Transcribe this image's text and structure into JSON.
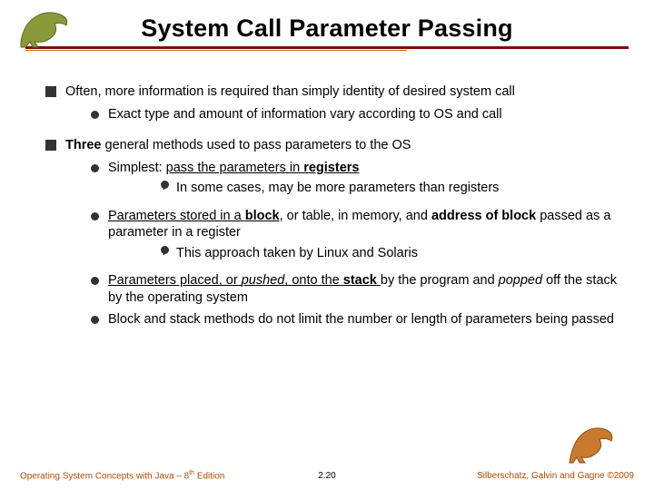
{
  "title": "System Call Parameter Passing",
  "bullets": {
    "a": {
      "text_pre": "Often, more information is required than simply identity of desired system call",
      "sub1": "Exact type and amount of information vary according to OS and call"
    },
    "b": {
      "text_pre": "Three",
      "text_post": " general methods used to pass parameters to the OS",
      "m1": {
        "pre": "Simplest:  ",
        "u": "pass the parameters in ",
        "ub": "registers",
        "sub": "In some cases, may be more parameters than registers"
      },
      "m2": {
        "u1": "Parameters stored in a ",
        "ub1": "block",
        "mid": ", or table, in memory, and ",
        "b2": "address of block",
        "post": " passed as a parameter in a register",
        "sub": "This approach taken by Linux and Solaris"
      },
      "m3": {
        "u1": "Parameters placed, or ",
        "ui": "pushed",
        "u2": ", onto the ",
        "ub": "stack ",
        "mid": "by the program and ",
        "i2": "popped",
        "post": " off the stack by the operating system"
      },
      "m4": "Block and stack methods do not limit the number or length of parameters being passed"
    }
  },
  "footer": {
    "left_a": "Operating System Concepts  with Java – 8",
    "left_th": "th",
    "left_b": " Edition",
    "center": "2.20",
    "right": "Silberschatz, Galvin and Gagne ©2009"
  }
}
